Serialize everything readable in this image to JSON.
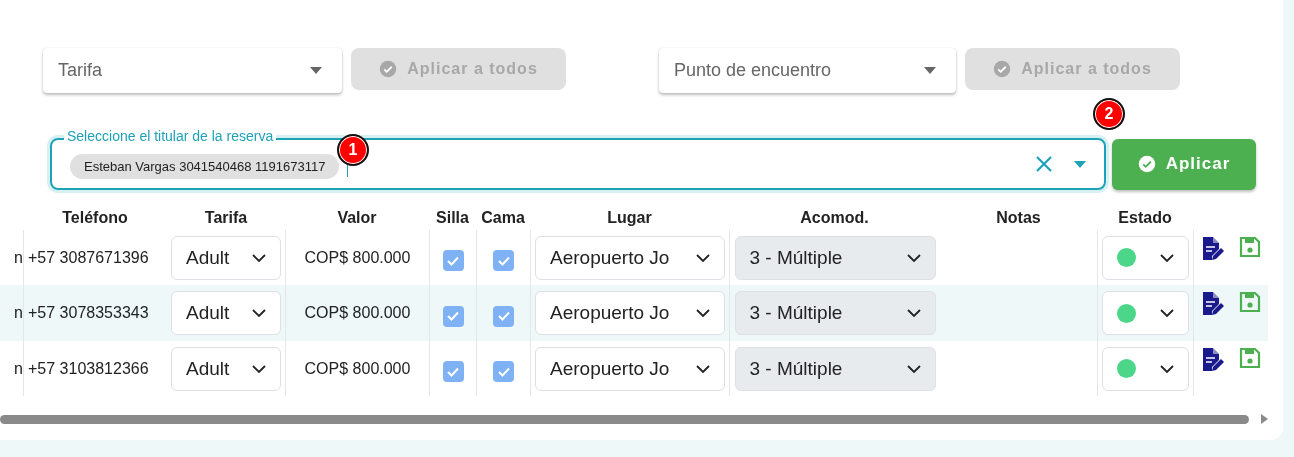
{
  "filters": [
    {
      "placeholder": "Tarifa",
      "button": "Aplicar a todos",
      "disabled": true
    },
    {
      "placeholder": "Punto de encuentro",
      "button": "Aplicar a todos",
      "disabled": true
    }
  ],
  "holder": {
    "label": "Seleccione el titular de la reserva",
    "chip": "Esteban Vargas 3041540468 1191673117",
    "badge": "1"
  },
  "apply": {
    "label": "Aplicar",
    "badge": "2"
  },
  "table": {
    "columns": [
      "Teléfono",
      "Tarifa",
      "Valor",
      "Silla",
      "Cama",
      "Lugar",
      "Acomod.",
      "Notas",
      "Estado"
    ],
    "rows": [
      {
        "column_1": "n",
        "phone": "+57 3087671396",
        "tarifa": "Adult",
        "valor": "COP$ 800.000",
        "silla": true,
        "cama": true,
        "lugar": "Aeropuerto Jo",
        "acomod": "3 - Múltiple",
        "color": "#4cd68a",
        "selected": false
      },
      {
        "column_1": "n",
        "phone": "+57 3078353343",
        "tarifa": "Adult",
        "valor": "COP$ 800.000",
        "silla": true,
        "cama": true,
        "lugar": "Aeropuerto Jo",
        "acomod": "3 - Múltiple",
        "color": "#4cd68a",
        "selected": true
      },
      {
        "column_1": "n",
        "phone": "+57 3103812366",
        "tarifa": "Adult",
        "valor": "COP$ 800.000",
        "silla": true,
        "cama": true,
        "lugar": "Aeropuerto Jo",
        "acomod": "3 - Múltiple",
        "color": "#4cd68a",
        "selected": false
      }
    ]
  }
}
